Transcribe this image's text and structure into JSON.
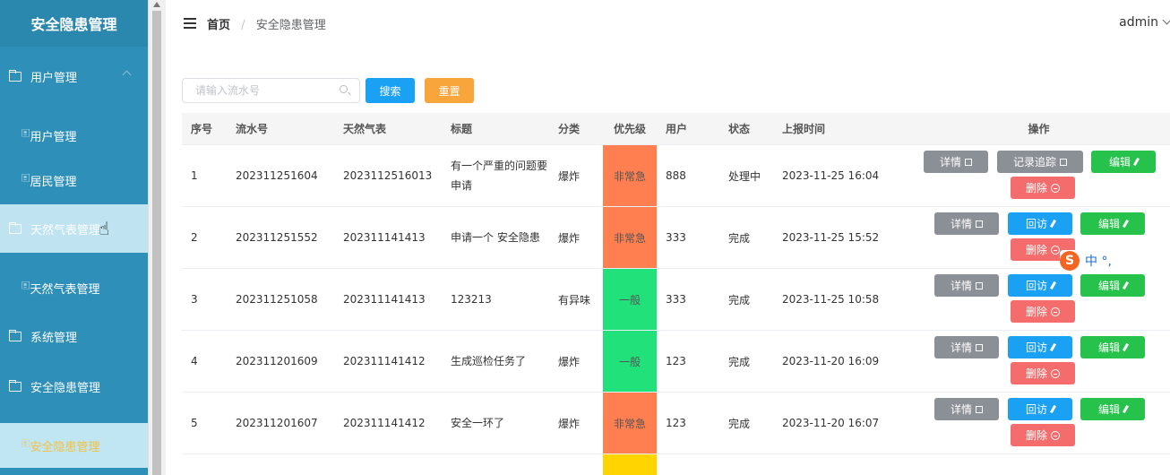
{
  "sidebar": {
    "title": "安全隐患管理",
    "menus": {
      "user_mgmt": "用户管理",
      "user_mgmt_sub1": "用户管理",
      "user_mgmt_sub2": "居民管理",
      "weather": "天然气表管理",
      "weather_sub": "天然气表管理",
      "system": "系统管理",
      "hazard": "安全隐患管理",
      "hazard_sub": "安全隐患管理"
    }
  },
  "topbar": {
    "breadcrumb_home": "首页",
    "breadcrumb_sep": "/",
    "breadcrumb_current": "安全隐患管理",
    "user": "admin"
  },
  "search": {
    "placeholder": "请输入流水号",
    "search_label": "搜索",
    "reset_label": "重置"
  },
  "table": {
    "headers": [
      "序号",
      "流水号",
      "天然气表",
      "标题",
      "分类",
      "优先级",
      "用户",
      "状态",
      "上报时间",
      "操作"
    ],
    "rows": [
      {
        "idx": "1",
        "sn": "202311251604",
        "wx": "2023112516013",
        "title": "有一个严重的问题要申请",
        "cat": "爆炸",
        "pri": "非常急",
        "pri_color": "#ff7f50",
        "user": "888",
        "status": "处理中",
        "time": "2023-11-25 16:04",
        "ops": "track"
      },
      {
        "idx": "2",
        "sn": "202311251552",
        "wx": "202311141413",
        "title": "申请一个 安全隐患",
        "cat": "爆炸",
        "pri": "非常急",
        "pri_color": "#ff7f50",
        "user": "333",
        "status": "完成",
        "time": "2023-11-25 15:52",
        "ops": "visit"
      },
      {
        "idx": "3",
        "sn": "202311251058",
        "wx": "202311141413",
        "title": "123213",
        "cat": "有异味",
        "pri": "一般",
        "pri_color": "#21e17b",
        "user": "333",
        "status": "完成",
        "time": "2023-11-25 10:58",
        "ops": "visit"
      },
      {
        "idx": "4",
        "sn": "202311201609",
        "wx": "202311141412",
        "title": "生成巡检任务了",
        "cat": "爆炸",
        "pri": "一般",
        "pri_color": "#21e17b",
        "user": "123",
        "status": "完成",
        "time": "2023-11-20 16:09",
        "ops": "visit"
      },
      {
        "idx": "5",
        "sn": "202311201607",
        "wx": "202311141412",
        "title": "安全一环了",
        "cat": "爆炸",
        "pri": "非常急",
        "pri_color": "#ff7f50",
        "user": "123",
        "status": "完成",
        "time": "2023-11-20 16:07",
        "ops": "visit"
      }
    ],
    "partial_row_color": "#ffd400",
    "ops_labels": {
      "detail": "详情",
      "track": "记录追踪",
      "visit": "回访",
      "edit": "编辑",
      "delete": "删除"
    }
  },
  "ime": {
    "logo": "S",
    "text": "中 °,"
  }
}
